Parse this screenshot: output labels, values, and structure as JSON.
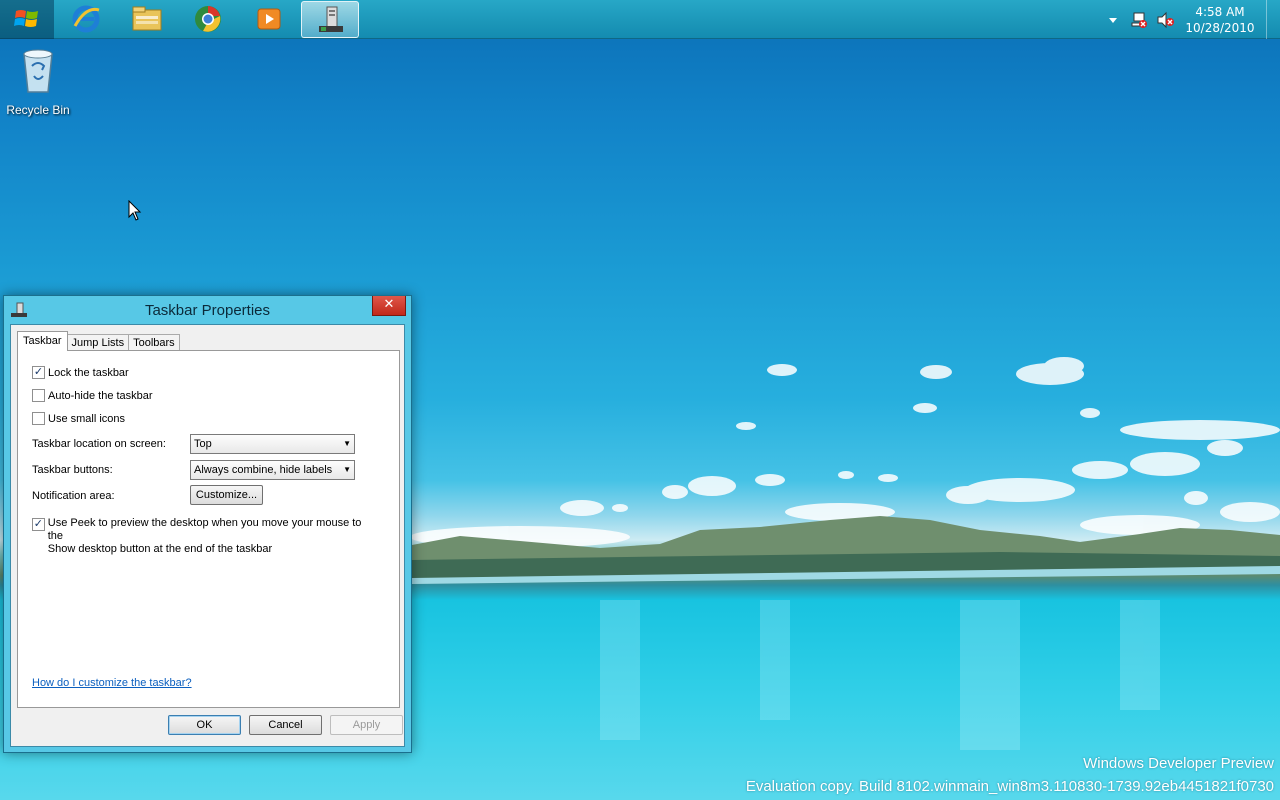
{
  "taskbar": {
    "start_icon": "windows-logo-icon",
    "pinned": [
      {
        "name": "internet-explorer-icon"
      },
      {
        "name": "file-explorer-icon"
      },
      {
        "name": "chrome-like-browser-icon"
      },
      {
        "name": "media-player-icon"
      },
      {
        "name": "taskbar-properties-icon",
        "active": true
      }
    ],
    "tray": {
      "overflow_icon": "chevron-up-icon",
      "network_icon": "network-icon",
      "volume_icon": "volume-muted-icon",
      "time": "4:58 AM",
      "date": "10/28/2010"
    }
  },
  "desktop": {
    "recycle_bin_label": "Recycle Bin",
    "watermark_line1": "Windows Developer Preview",
    "watermark_line2": "Evaluation copy. Build 8102.winmain_win8m3.110830-1739.92eb4451821f0730"
  },
  "dialog": {
    "title": "Taskbar Properties",
    "close_label": "✕",
    "tabs": [
      {
        "label": "Taskbar",
        "selected": true
      },
      {
        "label": "Jump Lists",
        "selected": false
      },
      {
        "label": "Toolbars",
        "selected": false
      }
    ],
    "options": {
      "lock_taskbar": {
        "label": "Lock the taskbar",
        "checked": true
      },
      "auto_hide": {
        "label": "Auto-hide the taskbar",
        "checked": false
      },
      "small_icons": {
        "label": "Use small icons",
        "checked": false
      }
    },
    "location_label": "Taskbar location on screen:",
    "location_value": "Top",
    "buttons_label": "Taskbar buttons:",
    "buttons_value": "Always combine, hide labels",
    "notification_label": "Notification area:",
    "customize_label": "Customize...",
    "peek": {
      "line1": "Use Peek to preview the desktop when you move your mouse to the",
      "line2": "Show desktop button at the end of the taskbar",
      "checked": true
    },
    "help_link": "How do I customize the taskbar?",
    "ok_label": "OK",
    "cancel_label": "Cancel",
    "apply_label": "Apply"
  }
}
